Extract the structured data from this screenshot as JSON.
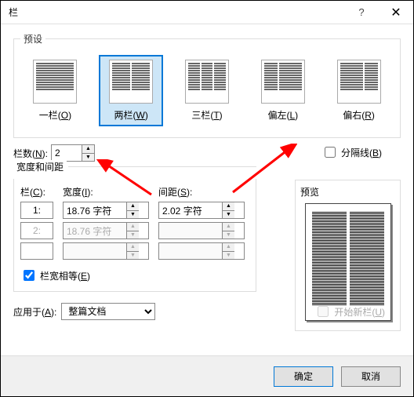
{
  "title": "栏",
  "presets": {
    "legend": "预设",
    "items": [
      {
        "label": "一栏(O)",
        "u": "O",
        "cols": [
          1
        ]
      },
      {
        "label": "两栏(W)",
        "u": "W",
        "cols": [
          1,
          1
        ]
      },
      {
        "label": "三栏(T)",
        "u": "T",
        "cols": [
          1,
          1,
          1
        ]
      },
      {
        "label": "偏左(L)",
        "u": "L",
        "cols": [
          "n",
          "w"
        ]
      },
      {
        "label": "偏右(R)",
        "u": "R",
        "cols": [
          "w",
          "n"
        ]
      }
    ],
    "selected": 1
  },
  "num_cols": {
    "label": "栏数(N):",
    "u": "N",
    "value": "2"
  },
  "separator": {
    "label": "分隔线(B)",
    "u": "B",
    "checked": false
  },
  "ws": {
    "legend": "宽度和间距",
    "col_head": "栏(C):",
    "col_u": "C",
    "width_head": "宽度(I):",
    "width_u": "I",
    "spacing_head": "间距(S):",
    "spacing_u": "S",
    "rows": [
      {
        "idx": "1:",
        "width": "18.76 字符",
        "spacing": "2.02 字符",
        "enabled": true
      },
      {
        "idx": "2:",
        "width": "18.76 字符",
        "spacing": "",
        "enabled": false
      }
    ],
    "equal": {
      "label": "栏宽相等(E)",
      "u": "E",
      "checked": true
    }
  },
  "preview": {
    "legend": "预览"
  },
  "apply": {
    "label": "应用于(A):",
    "u": "A",
    "value": "整篇文档",
    "newcol": {
      "label": "开始新栏(U)",
      "u": "U",
      "enabled": false
    }
  },
  "buttons": {
    "ok": "确定",
    "cancel": "取消"
  }
}
